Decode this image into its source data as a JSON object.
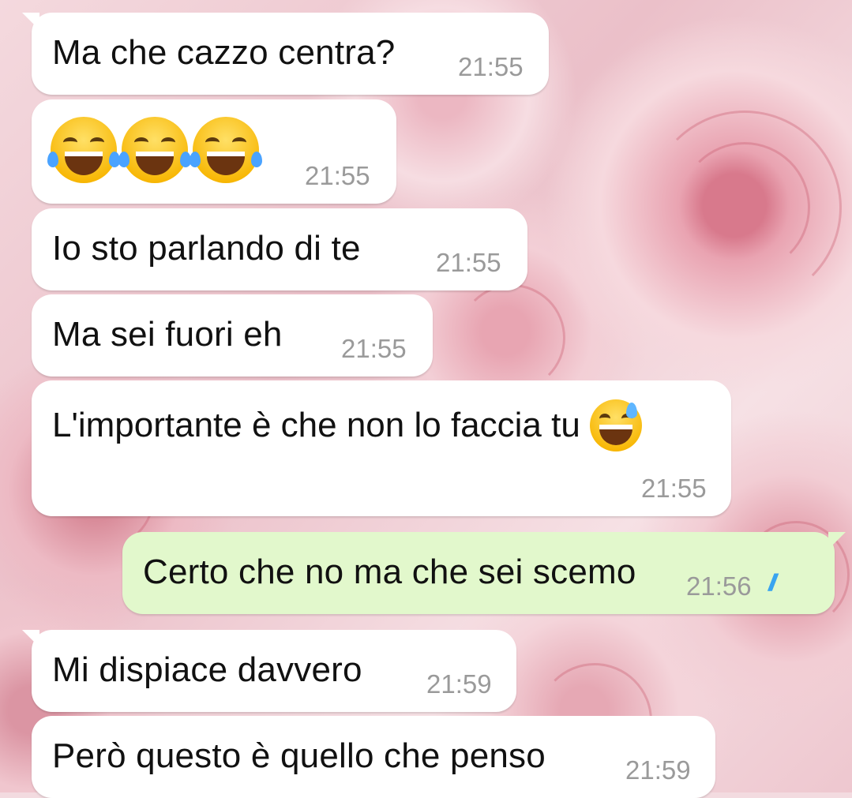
{
  "chat": {
    "messages": [
      {
        "direction": "in",
        "text": "Ma che cazzo centra?",
        "time": "21:55"
      },
      {
        "direction": "in",
        "emoji": [
          "face-with-tears-of-joy",
          "face-with-tears-of-joy",
          "face-with-tears-of-joy"
        ],
        "time": "21:55"
      },
      {
        "direction": "in",
        "text": "Io sto parlando di te",
        "time": "21:55"
      },
      {
        "direction": "in",
        "text": "Ma sei fuori eh",
        "time": "21:55"
      },
      {
        "direction": "in",
        "text": "L'importante è che non lo faccia tu",
        "emoji": [
          "grinning-face-with-sweat"
        ],
        "time": "21:55"
      },
      {
        "direction": "out",
        "text": "Certo che no ma che sei scemo",
        "time": "21:56",
        "status": "read",
        "status_icon": "double-check-icon",
        "status_color": "#39a4f0"
      },
      {
        "direction": "in",
        "text": "Mi dispiace davvero",
        "time": "21:59"
      },
      {
        "direction": "in",
        "text": "Però questo è quello che penso",
        "time": "21:59"
      }
    ]
  },
  "colors": {
    "incoming_bubble": "#ffffff",
    "outgoing_bubble": "#e2f8cc",
    "timestamp": "#9a9a9a",
    "read_ticks": "#39a4f0"
  },
  "wallpaper": {
    "icon": "pink-roses-wallpaper"
  }
}
